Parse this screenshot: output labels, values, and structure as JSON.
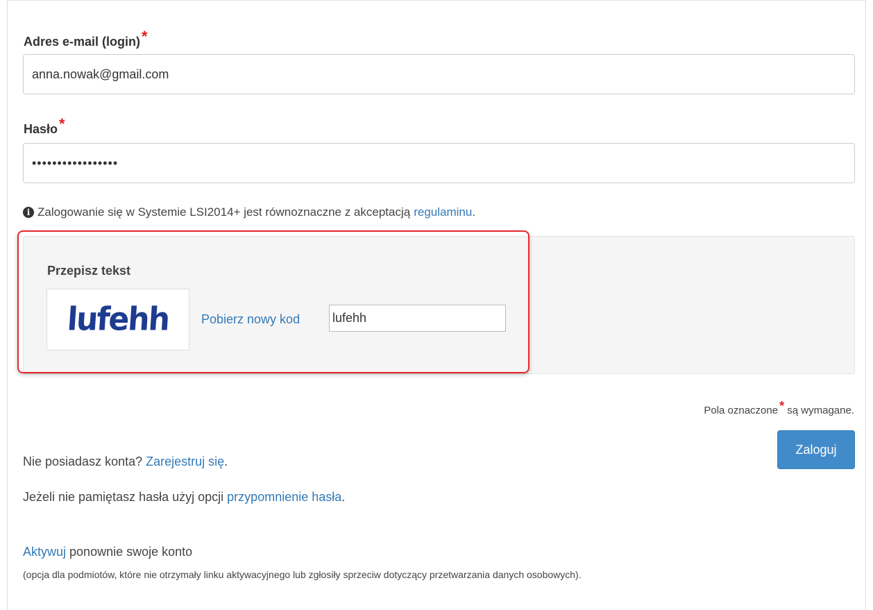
{
  "email": {
    "label": "Adres e-mail (login)",
    "required_mark": "*",
    "value": "anna.nowak@gmail.com"
  },
  "password": {
    "label": "Hasło",
    "required_mark": "*",
    "value": "•••••••••••••••••"
  },
  "terms": {
    "text": "Zalogowanie się w Systemie LSI2014+ jest równoznaczne z akceptacją",
    "link": "regulaminu",
    "suffix": ".",
    "icon": "info-icon"
  },
  "captcha": {
    "title": "Przepisz tekst",
    "image_text": "lufehh",
    "new_code_link": "Pobierz nowy kod",
    "value": "lufehh"
  },
  "required_note": {
    "prefix": "Pola oznaczone",
    "mark": "*",
    "suffix": "są wymagane."
  },
  "login_button": "Zaloguj",
  "register": {
    "text": "Nie posiadasz konta?",
    "link": "Zarejestruj się",
    "suffix": "."
  },
  "reminder": {
    "text": "Jeżeli nie pamiętasz hasła użyj opcji",
    "link": "przypomnienie hasła",
    "suffix": "."
  },
  "activate": {
    "link": "Aktywuj",
    "text": "ponownie swoje konto",
    "note": "(opcja dla podmiotów, które nie otrzymały linku aktywacyjnego lub zgłosiły sprzeciw dotyczący przetwarzania danych osobowych)."
  },
  "colors": {
    "link": "#337ab7",
    "primary": "#428bca",
    "required": "#e02020",
    "highlight": "#e8272b"
  }
}
